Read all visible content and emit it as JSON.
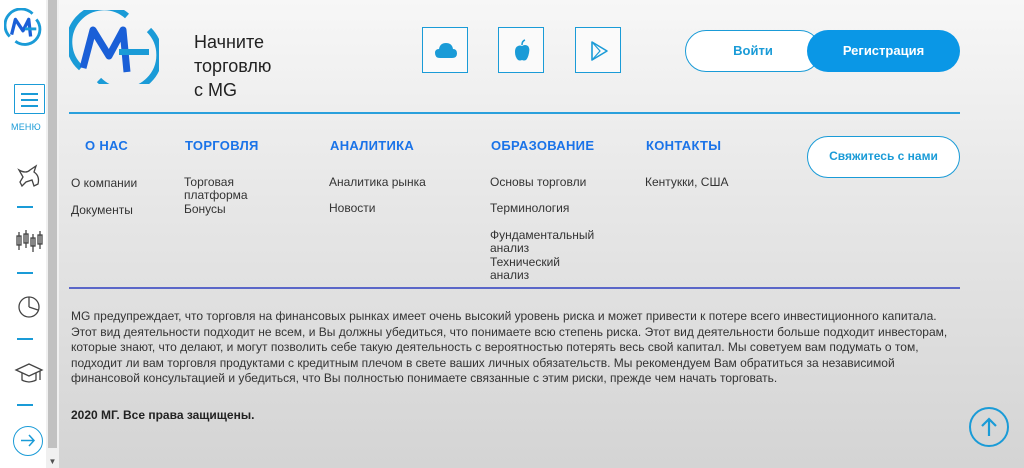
{
  "sidebar": {
    "menu_label": "МЕНЮ",
    "icons": [
      "bull-icon",
      "candlestick-icon",
      "pie-chart-icon",
      "graduation-cap-icon",
      "arrow-right-icon"
    ]
  },
  "header": {
    "tagline": "Начните\nторговлю\nс MG",
    "stores": [
      "cloud-icon",
      "apple-icon",
      "google-play-icon"
    ],
    "login_label": "Войти",
    "register_label": "Регистрация"
  },
  "footer_nav": {
    "columns": [
      {
        "heading": "О НАС",
        "links": [
          "О компании",
          "Документы"
        ]
      },
      {
        "heading": "ТОРГОВЛЯ",
        "links": [
          "Торговая платформа",
          "Бонусы"
        ]
      },
      {
        "heading": "АНАЛИТИКА",
        "links": [
          "Аналитика рынка",
          "Новости"
        ]
      },
      {
        "heading": "ОБРАЗОВАНИЕ",
        "links": [
          "Основы торговли",
          "Терминология",
          "Фундаментальный анализ",
          "Технический анализ"
        ]
      },
      {
        "heading": "КОНТАКТЫ",
        "links": [
          "Кентукки, США"
        ]
      }
    ],
    "contact_button": "Свяжитесь с нами"
  },
  "disclaimer": "MG предупреждает, что торговля на финансовых рынках имеет очень высокий уровень риска и может привести к потере всего инвестиционного капитала. Этот вид деятельности подходит не всем, и Вы должны убедиться, что понимаете всю степень риска. Этот вид деятельности больше подходит инвесторам, которые знают, что делают, и могут позволить себе такую деятельность с вероятностью потерять весь свой капитал. Мы советуем вам подумать о том, подходит ли вам торговля продуктами с кредитным плечом в свете ваших личных обязательств. Мы рекомендуем Вам обратиться за независимой финансовой консультацией и убедиться, что Вы полностью понимаете связанные с этим риски, прежде чем начать торговать.",
  "copyright": "2020 МГ. Все права защищены.",
  "colors": {
    "accent": "#1a9bd7",
    "heading": "#1a73e8",
    "primary_button": "#0a97e6"
  }
}
